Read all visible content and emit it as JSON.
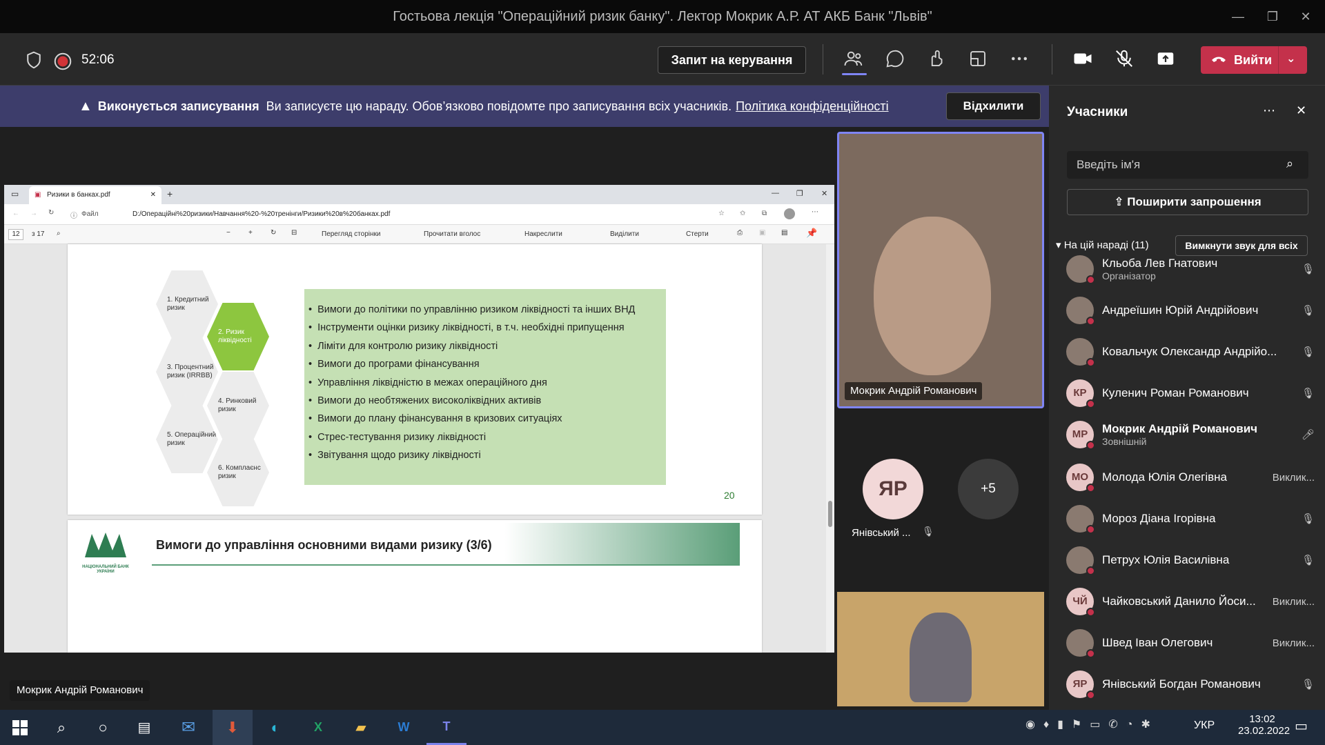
{
  "window": {
    "title": "Гостьова лекція \"Операційний ризик банку\". Лектор Мокрик А.Р. АТ АКБ Банк \"Львів\""
  },
  "meeting": {
    "timer": "52:06",
    "request_control": "Запит на керування",
    "leave": "Вийти"
  },
  "banner": {
    "bold": "Виконується записування",
    "text": "Ви записуєте цю нараду. Обов’язково повідомте про записування всіх учасників.",
    "link": "Політика конфіденційності",
    "dismiss": "Відхилити"
  },
  "browser": {
    "tab_title": "Ризики в банках.pdf",
    "address_prefix": "Файл",
    "address": "D:/Операційні%20ризики/Навчання%20-%20тренінги/Ризики%20в%20банках.pdf",
    "page_num": "12",
    "page_total": "з 17",
    "tools": [
      "Перегляд сторінки",
      "Прочитати вголос",
      "Накреслити",
      "Виділити",
      "Стерти"
    ]
  },
  "slide": {
    "hexes": [
      "1. Кредитний ризик",
      "2. Ризик ліквідності",
      "3. Процентний ризик (IRRBB)",
      "4. Ринковий ризик",
      "5. Операційний ризик",
      "6. Комплаєнс ризик"
    ],
    "bullets": [
      "Вимоги до політики по управлінню ризиком ліквідності та інших ВНД",
      "Інструменти оцінки ризику ліквідності, в т.ч. необхідні припущення",
      "Ліміти для контролю ризику ліквідності",
      "Вимоги до програми фінансування",
      "Управління ліквідністю в межах операційного дня",
      "Вимоги до необтяжених високоліквідних активів",
      "Вимоги до плану фінансування в кризових ситуаціях",
      "Стрес-тестування ризику ліквідності",
      "Звітування щодо ризику ліквідності"
    ],
    "page_number": "20",
    "next_title": "Вимоги до управління основними видами ризику (3/6)",
    "logo_text": "НАЦІОНАЛЬНИЙ БАНК УКРАЇНИ"
  },
  "video": {
    "speaker": "Мокрик Андрій Романович",
    "small_name": "Янівський ...",
    "small_initials": "ЯР",
    "more": "+5",
    "stage_label": "Мокрик Андрій Романович"
  },
  "panel": {
    "title": "Учасники",
    "search_placeholder": "Введіть ім'я",
    "invite": "Поширити запрошення",
    "section": "На цій нараді (11)",
    "mute_all": "Вимкнути звук для всіх",
    "participants": [
      {
        "name": "Кльоба Лев Гнатович",
        "role": "Організатор",
        "initials": "",
        "status": ""
      },
      {
        "name": "Андреїшин Юрій Андрійович",
        "role": "",
        "initials": "",
        "status": ""
      },
      {
        "name": "Ковальчук Олександр Андрійо...",
        "role": "",
        "initials": "",
        "status": ""
      },
      {
        "name": "Куленич Роман Романович",
        "role": "",
        "initials": "КР",
        "status": ""
      },
      {
        "name": "Мокрик Андрій Романович",
        "role": "Зовнішній",
        "initials": "МР",
        "status": ""
      },
      {
        "name": "Молода Юлія Олегівна",
        "role": "",
        "initials": "МО",
        "status": "Виклик..."
      },
      {
        "name": "Мороз Діана Ігорівна",
        "role": "",
        "initials": "",
        "status": ""
      },
      {
        "name": "Петрух Юлія Василівна",
        "role": "",
        "initials": "",
        "status": ""
      },
      {
        "name": "Чайковський Данило Йоси...",
        "role": "",
        "initials": "ЧЙ",
        "status": "Виклик..."
      },
      {
        "name": "Швед Іван Олегович",
        "role": "",
        "initials": "",
        "status": "Виклик..."
      },
      {
        "name": "Янівський Богдан Романович",
        "role": "",
        "initials": "ЯР",
        "status": ""
      }
    ]
  },
  "taskbar": {
    "lang": "УКР",
    "time": "13:02",
    "date": "23.02.2022"
  }
}
